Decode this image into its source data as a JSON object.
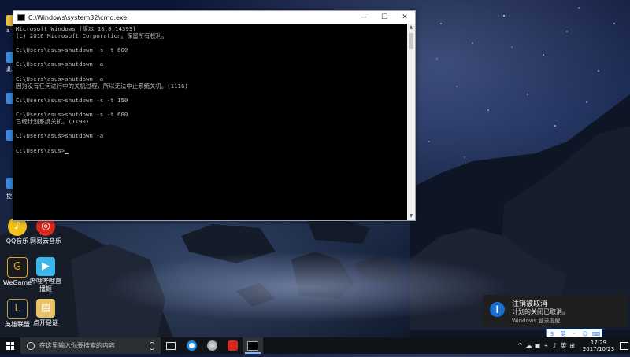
{
  "cmd": {
    "title": "C:\\Windows\\system32\\cmd.exe",
    "lines": [
      "Microsoft Windows [版本 10.0.14393]",
      "(c) 2016 Microsoft Corporation。保留所有权利。",
      "",
      "C:\\Users\\asus>shutdown -s -t 600",
      "",
      "C:\\Users\\asus>shutdown -a",
      "",
      "C:\\Users\\asus>shutdown -a",
      "因为没有任何进行中的关机过程，所以无法中止系统关机。(1116)",
      "",
      "C:\\Users\\asus>shutdown -s -t 150",
      "",
      "C:\\Users\\asus>shutdown -s -t 600",
      "已经计划系统关机。(1190)",
      "",
      "C:\\Users\\asus>shutdown -a",
      "",
      "C:\\Users\\asus>"
    ],
    "min_glyph": "—",
    "max_glyph": "☐",
    "close_glyph": "✕"
  },
  "desktop_icons": [
    {
      "label": "QQ音乐",
      "color": "#f3c21a"
    },
    {
      "label": "网易云音乐",
      "color": "#d8281f"
    },
    {
      "label": "WeGame",
      "color": "#e2a117"
    },
    {
      "label": "哔哩哔哩直播姬",
      "color": "#39b7ea"
    },
    {
      "label": "英雄联盟",
      "color": "#c89b3c"
    },
    {
      "label": "点开是谜",
      "color": "#e8c26a"
    }
  ],
  "left_partial_labels": [
    "a",
    "此",
    "控"
  ],
  "toast": {
    "title": "注销被取消",
    "message": "计划的关闭已取消。",
    "source": "Windows 登录提醒",
    "icon_glyph": "i"
  },
  "ime": {
    "items": [
      "S",
      "英",
      "·",
      "☺",
      "⌨"
    ]
  },
  "taskbar": {
    "search_placeholder": "在这里输入你要搜索的内容",
    "tray_icons": [
      "^",
      "☁",
      "▣",
      "⌁",
      "♪",
      "英",
      "⊞"
    ],
    "ime_label": "英",
    "time": "17:29",
    "date": "2017/10/23"
  }
}
